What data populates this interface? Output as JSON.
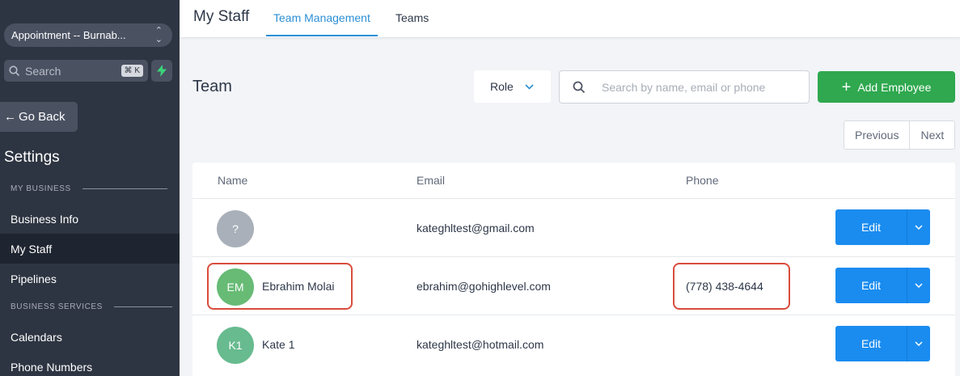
{
  "sidebar": {
    "location_select": "Appointment -- Burnab...",
    "search_placeholder": "Search",
    "search_shortcut": "⌘ K",
    "go_back": "Go Back",
    "settings_title": "Settings",
    "section_my_business": "MY BUSINESS",
    "section_business_services": "BUSINESS SERVICES",
    "items": [
      {
        "label": "Business Info"
      },
      {
        "label": "My Staff"
      },
      {
        "label": "Pipelines"
      },
      {
        "label": "Calendars"
      },
      {
        "label": "Phone Numbers"
      }
    ]
  },
  "header": {
    "title": "My Staff",
    "tabs": [
      {
        "label": "Team Management"
      },
      {
        "label": "Teams"
      }
    ]
  },
  "main": {
    "title": "Team",
    "role_filter": "Role",
    "search_placeholder": "Search by name, email or phone",
    "add_button": "Add Employee",
    "pager": {
      "previous": "Previous",
      "next": "Next"
    }
  },
  "table": {
    "columns": [
      "Name",
      "Email",
      "Phone"
    ],
    "edit_label": "Edit",
    "rows": [
      {
        "initials": "?",
        "name": "",
        "email": "kateghltest@gmail.com",
        "phone": "",
        "avatar_color": "#a9b0b9"
      },
      {
        "initials": "EM",
        "name": "Ebrahim Molai",
        "email": "ebrahim@gohighlevel.com",
        "phone": "(778) 438-4644",
        "avatar_color": "#67bb75"
      },
      {
        "initials": "K1",
        "name": "Kate 1",
        "email": "kateghltest@hotmail.com",
        "phone": "",
        "avatar_color": "#67bb8f"
      }
    ]
  },
  "colors": {
    "sidebar_bg": "#2e3542",
    "accent_blue": "#2b8fd6",
    "add_green": "#2fa84f",
    "edit_blue": "#1a8cf0",
    "highlight_red": "#d94c3d"
  }
}
